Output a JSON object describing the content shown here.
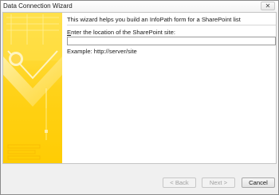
{
  "window": {
    "title": "Data Connection Wizard",
    "close_glyph": "✕"
  },
  "wizard": {
    "intro_text": "This wizard helps you build an InfoPath form for a SharePoint list",
    "location_label_accel": "E",
    "location_label_rest": "nter the location of the SharePoint site:",
    "location_value": "",
    "example_text": "Example: http://server/site"
  },
  "buttons": {
    "back": "< Back",
    "next": "Next >",
    "cancel": "Cancel"
  },
  "colors": {
    "art_yellow": "#ffd21a",
    "art_light": "#ffe97a",
    "art_orange": "#f2b400"
  },
  "icons": {
    "close": "close-icon"
  }
}
